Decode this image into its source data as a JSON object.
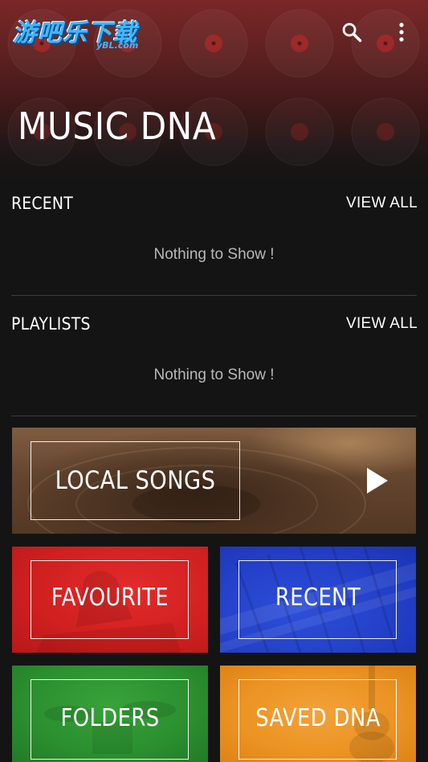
{
  "header": {
    "logo_text": "游吧乐下载",
    "logo_sub": "yBL.com",
    "search_icon": "search-icon",
    "more_icon": "more-vertical-icon",
    "title": "MUSIC DNA",
    "accent_color": "#7a2727"
  },
  "recent": {
    "title": "RECENT",
    "view_all": "VIEW ALL",
    "empty_message": "Nothing to Show !"
  },
  "playlists": {
    "title": "PLAYLISTS",
    "view_all": "VIEW ALL",
    "empty_message": "Nothing to Show !"
  },
  "tiles": {
    "local_songs": {
      "label": "LOCAL SONGS",
      "icon": "play-icon",
      "color": "#6e4c33"
    },
    "favourite": {
      "label": "FAVOURITE",
      "color": "#cf1f1f"
    },
    "recent": {
      "label": "RECENT",
      "color": "#2340c8"
    },
    "folders": {
      "label": "FOLDERS",
      "color": "#2b8f2f"
    },
    "saved_dna": {
      "label": "SAVED DNA",
      "color": "#ec9424"
    }
  }
}
